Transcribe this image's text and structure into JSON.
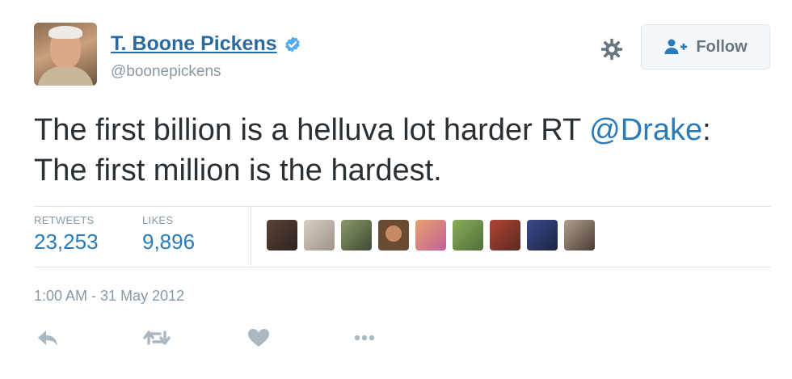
{
  "author": {
    "name": "T. Boone Pickens",
    "handle": "@boonepickens",
    "verified": true,
    "avatar_icon": "user-avatar"
  },
  "header": {
    "settings_icon": "gear-icon",
    "follow_label": "Follow",
    "follow_icon": "person-add-icon"
  },
  "tweet": {
    "text_part1": "The first billion is a helluva lot harder RT ",
    "mention": "@Drake",
    "text_part2": ": The first million is the hardest."
  },
  "stats": {
    "retweets_label": "RETWEETS",
    "retweets_value": "23,253",
    "likes_label": "LIKES",
    "likes_value": "9,896"
  },
  "likers": {
    "count": 9,
    "colors": [
      "#5a4236",
      "#b8b0a4",
      "#6d7a5a",
      "#9c6b4e",
      "#d88a5c",
      "#7a9a4a",
      "#8c3a2e",
      "#3a3f6a",
      "#9a8a78"
    ]
  },
  "timestamp": "1:00 AM - 31 May 2012",
  "actions": [
    "reply-icon",
    "retweet-icon",
    "like-icon",
    "more-icon"
  ],
  "colors": {
    "name": "#2b6a9e",
    "link": "#2b7bb9",
    "muted": "#8899a6",
    "text": "#292f33",
    "divider": "#e1e8ed",
    "verified": "#55acee",
    "icon": "#aab8c2"
  }
}
